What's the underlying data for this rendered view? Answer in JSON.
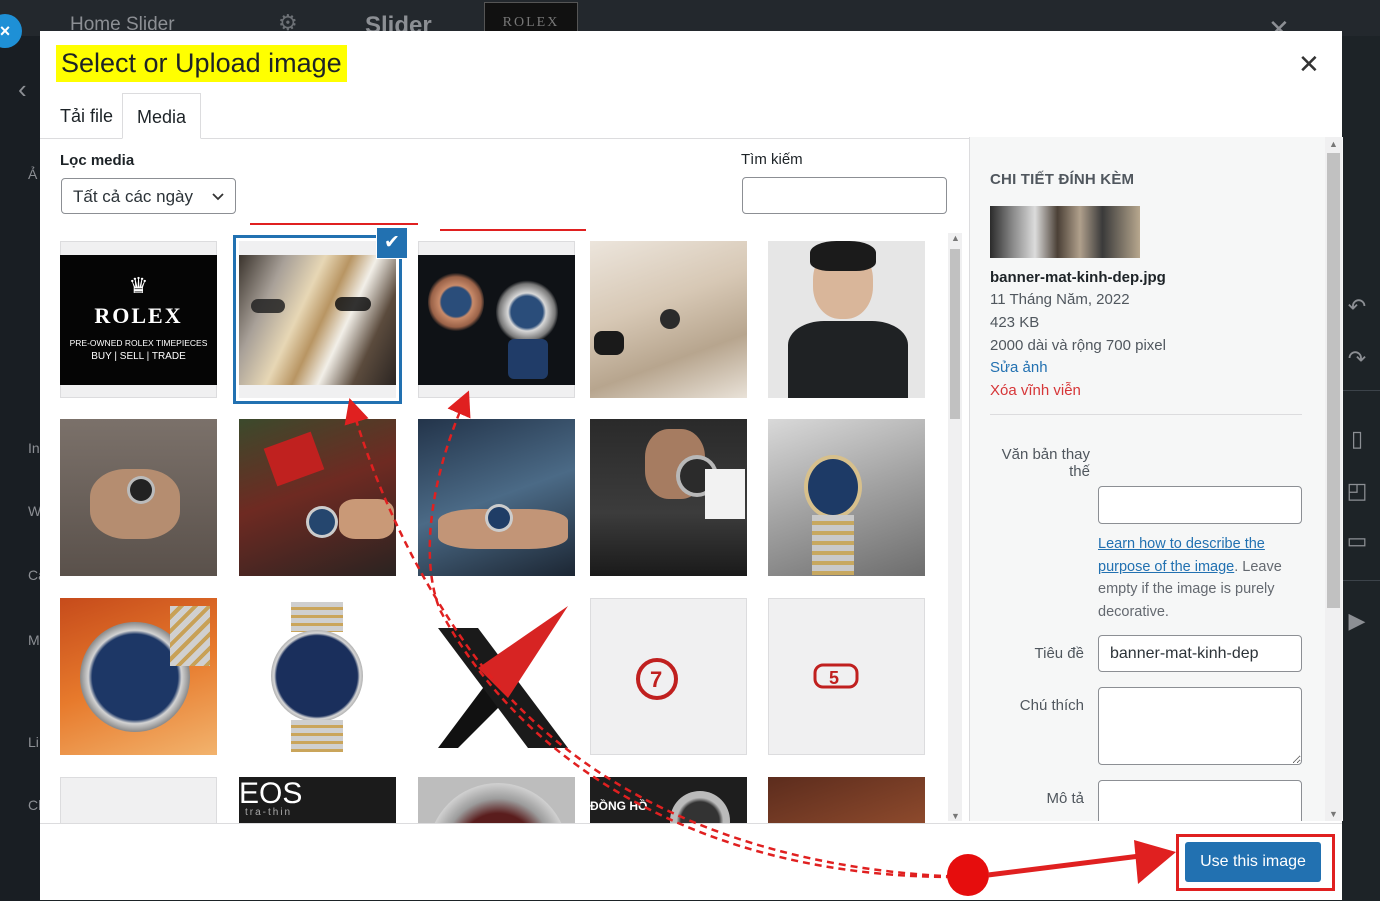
{
  "background": {
    "panel_title": "Home Slider",
    "slider_label": "Slider",
    "thumb_text": "ROLEX",
    "left_letters": [
      "Ả",
      "In",
      "W",
      "Ca",
      "M",
      "Li",
      "Cl"
    ]
  },
  "modal": {
    "title": "Select or Upload image",
    "tabs": [
      {
        "label": "Tải file"
      },
      {
        "label": "Media"
      }
    ],
    "active_tab": "Media",
    "filter": {
      "label": "Lọc media",
      "selected": "Tất cả các ngày"
    },
    "search": {
      "label": "Tìm kiếm",
      "value": ""
    },
    "grid": [
      {
        "name": "rolex-logo",
        "selected": false,
        "lines": [
          "ROLEX",
          "PRE-OWNED ROLEX TIMEPIECES",
          "BUY  |  SELL  |  TRADE"
        ]
      },
      {
        "name": "banner-mat-kinh-dep",
        "selected": true,
        "lines": []
      },
      {
        "name": "watches-blue",
        "selected": false,
        "lines": []
      },
      {
        "name": "man-sitting-watch",
        "selected": false,
        "lines": []
      },
      {
        "name": "man-portrait",
        "selected": false,
        "lines": []
      },
      {
        "name": "wrist-watch-1",
        "selected": false,
        "lines": []
      },
      {
        "name": "gift-watch",
        "selected": false,
        "lines": []
      },
      {
        "name": "wrist-watch-2",
        "selected": false,
        "lines": []
      },
      {
        "name": "cuff-watch",
        "selected": false,
        "lines": []
      },
      {
        "name": "citizen-wrist",
        "selected": false,
        "lines": []
      },
      {
        "name": "citizen-watch-1",
        "selected": false,
        "lines": []
      },
      {
        "name": "citizen-watch-2",
        "selected": false,
        "lines": []
      },
      {
        "name": "x-logo",
        "selected": false,
        "lines": []
      },
      {
        "name": "icon-7",
        "selected": false,
        "lines": []
      },
      {
        "name": "icon-5",
        "selected": false,
        "lines": []
      },
      {
        "name": "blank",
        "selected": false,
        "lines": []
      },
      {
        "name": "eos-banner",
        "selected": false,
        "lines": [
          "EOS",
          "tra-thin"
        ]
      },
      {
        "name": "watch-closeup",
        "selected": false,
        "lines": []
      },
      {
        "name": "dong-ho-banner",
        "selected": false,
        "lines": [
          "ĐỒNG HỒ"
        ]
      },
      {
        "name": "rusty-watch",
        "selected": false,
        "lines": []
      }
    ],
    "details": {
      "heading": "CHI TIẾT ĐÍNH KÈM",
      "filename": "banner-mat-kinh-dep.jpg",
      "date": "11 Tháng Năm, 2022",
      "size": "423 KB",
      "dimensions": "2000 dài và rộng 700 pixel",
      "edit": "Sửa ảnh",
      "delete": "Xóa vĩnh viễn",
      "alt_label_1": "Văn bản thay",
      "alt_label_2": "thế",
      "alt_value": "",
      "help_link_1": "Learn how to describe the",
      "help_link_2": "purpose of the image",
      "help_rest": ". Leave empty if the image is purely decorative.",
      "title_label": "Tiêu đề",
      "title_value": "banner-mat-kinh-dep",
      "caption_label": "Chú thích",
      "caption_value": "",
      "desc_label": "Mô tả",
      "desc_value": ""
    },
    "button": "Use this image"
  },
  "colors": {
    "accent": "#2271b1",
    "annotation": "#e02020",
    "highlight": "#ffff00"
  }
}
